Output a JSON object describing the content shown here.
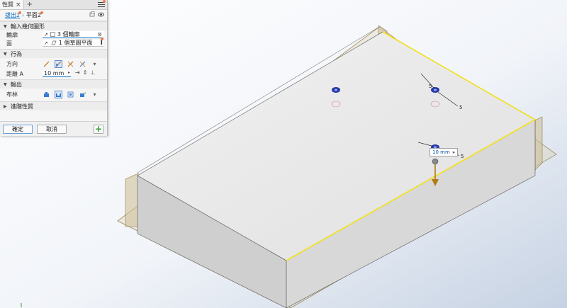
{
  "panel": {
    "tab_label": "性質",
    "tab_close": "×",
    "tab_add": "+",
    "breadcrumb": {
      "link": "拔出2",
      "sep": "›",
      "current": "平面2"
    },
    "sections": {
      "input_geometry": {
        "title": "輸入幾何圖形",
        "contour_label": "輪廓",
        "contour_value": "3 個輪廓",
        "contour_clear": "⊗",
        "face_label": "面",
        "face_value": "1 個草圖平面",
        "face_cursor": "I"
      },
      "behavior": {
        "title": "行為",
        "direction_label": "方向",
        "distance_label": "距離 A",
        "distance_value": "10 mm",
        "distance_arrow": "▸"
      },
      "output": {
        "title": "輸出",
        "boolean_label": "布林"
      },
      "advanced": {
        "title": "進階性質"
      }
    },
    "buttons": {
      "ok": "確定",
      "cancel": "取消",
      "add": "+"
    }
  },
  "viewport": {
    "dimension_value": "10 mm",
    "dimension_arrow": "▸",
    "callout_a": "5",
    "callout_b": "5",
    "callout_c": "5"
  },
  "colors": {
    "accent": "#0a6fc2",
    "highlight_edge": "#f2e01a",
    "notify_dot": "#f0784a",
    "direction_arrow": "#b07a10"
  }
}
